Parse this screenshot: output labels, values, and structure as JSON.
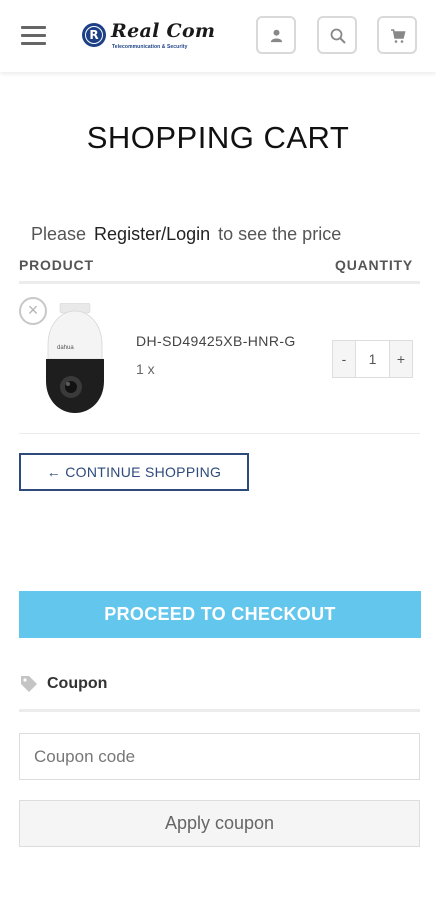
{
  "header": {
    "brand_name": "Real Com",
    "brand_tagline": "Telecommunication & Security",
    "brand_color": "#1c3f86",
    "icons": [
      "menu-icon",
      "user-icon",
      "search-icon",
      "cart-icon"
    ]
  },
  "page": {
    "title": "SHOPPING CART"
  },
  "login_notice": {
    "prefix": "Please",
    "link": "Register/Login",
    "suffix": "to see the price"
  },
  "table": {
    "columns": [
      "PRODUCT",
      "QUANTITY"
    ],
    "rows": [
      {
        "name": "DH-SD49425XB-HNR-G",
        "qty_text": "1 x",
        "quantity": "1",
        "minus": "-",
        "plus": "+",
        "remove": "×",
        "camera_label": "dahua"
      }
    ]
  },
  "actions": {
    "continue_label": "← CONTINUE SHOPPING",
    "checkout_label": "PROCEED TO CHECKOUT",
    "checkout_color": "#63c6ec"
  },
  "coupon": {
    "heading": "Coupon",
    "placeholder": "Coupon code",
    "apply_label": "Apply coupon"
  }
}
